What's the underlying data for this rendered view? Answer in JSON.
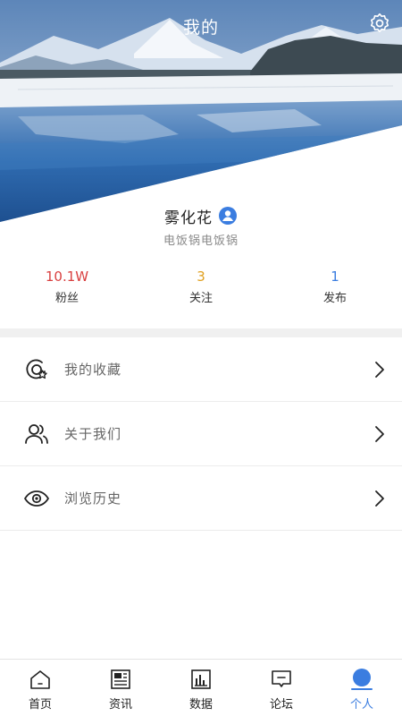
{
  "header": {
    "title": "我的"
  },
  "profile": {
    "name": "雾化花",
    "bio": "电饭锅电饭锅"
  },
  "stats": [
    {
      "value": "10.1W",
      "label": "粉丝",
      "color": "#d94040"
    },
    {
      "value": "3",
      "label": "关注",
      "color": "#e0a020"
    },
    {
      "value": "1",
      "label": "发布",
      "color": "#3b7de0"
    }
  ],
  "menu": [
    {
      "label": "我的收藏",
      "icon": "favorites-icon"
    },
    {
      "label": "关于我们",
      "icon": "users-icon"
    },
    {
      "label": "浏览历史",
      "icon": "eye-icon"
    }
  ],
  "tabs": [
    {
      "label": "首页",
      "icon": "home-icon"
    },
    {
      "label": "资讯",
      "icon": "news-icon"
    },
    {
      "label": "数据",
      "icon": "chart-icon"
    },
    {
      "label": "论坛",
      "icon": "forum-icon"
    },
    {
      "label": "个人",
      "icon": "person-icon",
      "active": true
    }
  ],
  "colors": {
    "accent": "#3b7de0",
    "hero_sky": "#6f94c2",
    "hero_water": "#2f6bb0"
  }
}
